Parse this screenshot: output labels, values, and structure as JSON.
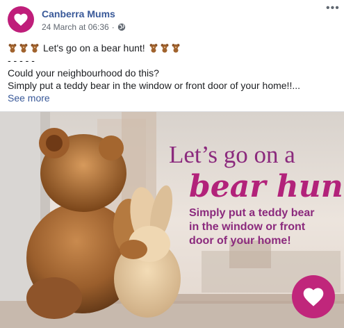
{
  "post": {
    "page_name": "Canberra Mums",
    "timestamp": "24 March at 06:36",
    "separator": "·",
    "audience_icon": "globe-icon",
    "more_options_icon": "ellipsis-icon",
    "text_lines": [
      "Let's go on a bear hunt!",
      "- - - - -",
      "Could your neighbourhood do this?",
      "Simply put a teddy bear in the window or front door of your home!!..."
    ],
    "see_more": "See more",
    "emoji_icon": "teddy-bear-emoji"
  },
  "image": {
    "headline_line1": "Let’s go on a",
    "headline_line2": "bear hunt!",
    "subtext_lines": [
      "Simply put a teddy bear",
      "in the window or front",
      "door of your home!"
    ],
    "logo_icon": "heart-logo-icon"
  },
  "colors": {
    "brand": "#bf1e7a",
    "headline": "#8b2a7d",
    "link": "#385898",
    "meta": "#606770"
  }
}
